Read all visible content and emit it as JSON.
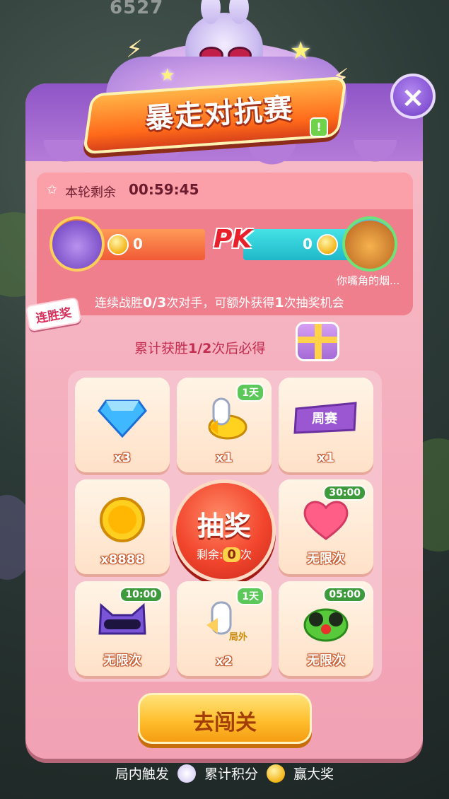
{
  "hud": {
    "score": "6527"
  },
  "event": {
    "title": "暴走对抗赛",
    "info_badge": "!",
    "close_symbol": "×"
  },
  "round": {
    "timer_label": "本轮剩余",
    "timer_value": "00:59:45"
  },
  "pk": {
    "badge": "PK",
    "my_score": "0",
    "opponent_score": "0",
    "opponent_name": "你嘴角的烟..."
  },
  "streak": {
    "tag": "连胜奖",
    "text_prefix": "连续战胜",
    "progress": "0/3",
    "text_middle": "次对手，可额外获得",
    "reward_count": "1",
    "text_suffix": "次抽奖机会"
  },
  "cumulative": {
    "prefix": "累计获胜",
    "progress": "1/2",
    "suffix": "次后必得"
  },
  "rewards": [
    {
      "icon": "diamond-icon",
      "qty": "x3",
      "tag": ""
    },
    {
      "icon": "glove-icon",
      "qty": "x1",
      "tag": "1天"
    },
    {
      "icon": "ticket-icon",
      "qty": "x1",
      "tag": "",
      "ticket_text": "周赛"
    },
    {
      "icon": "coin-icon",
      "qty": "x8888",
      "tag": ""
    },
    {
      "icon": "heart-icon",
      "qty": "无限次",
      "tag": "30:00"
    },
    {
      "icon": "cat-mask-icon",
      "qty": "无限次",
      "tag": "10:00"
    },
    {
      "icon": "glove-x3-icon",
      "qty": "x2",
      "tag": "1天",
      "extra": "局外"
    },
    {
      "icon": "frog-icon",
      "qty": "无限次",
      "tag": "05:00"
    }
  ],
  "draw": {
    "label": "抽奖",
    "remaining_prefix": "剩余:",
    "remaining_count": "0",
    "remaining_suffix": "次"
  },
  "go_button": {
    "label": "去闯关"
  },
  "footer": {
    "part1": "局内触发",
    "part2": "累计积分",
    "part3": "赢大奖"
  },
  "colors": {
    "panel": "#f3a6b6",
    "header_purple": "#8e55c7",
    "accent_orange": "#f15a36",
    "accent_teal": "#1fb8c9",
    "go_button": "#ffbf2e"
  }
}
